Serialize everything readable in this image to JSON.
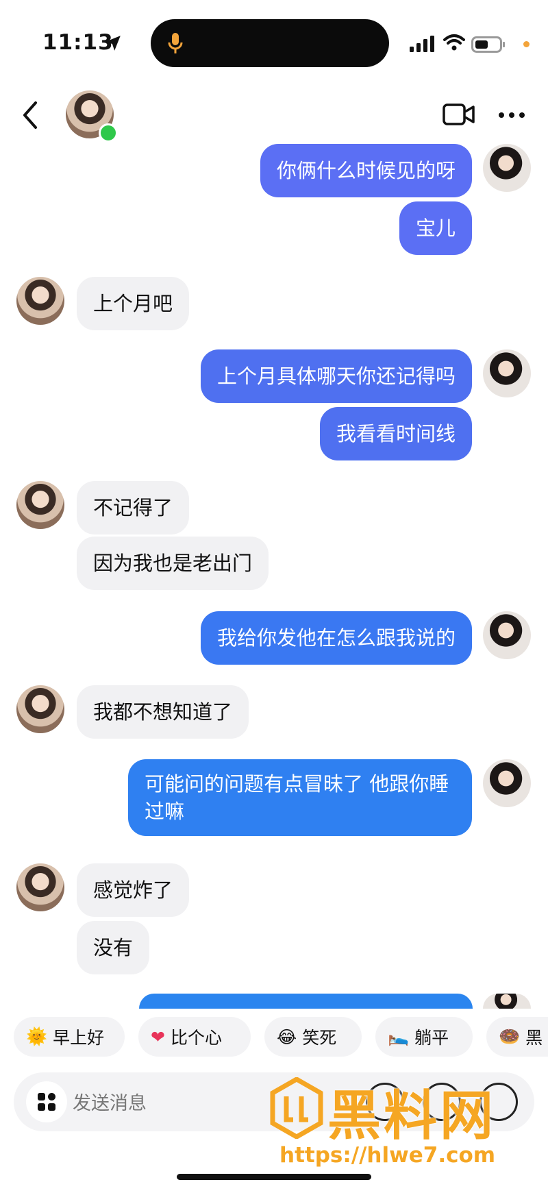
{
  "status": {
    "time": "11:13"
  },
  "messages": [
    {
      "side": "out",
      "text": "你俩什么时候见的呀",
      "color": "#5b6ff4"
    },
    {
      "side": "out",
      "text": "宝儿",
      "color": "#5b6ff4"
    },
    {
      "side": "in",
      "text": "上个月吧"
    },
    {
      "side": "out",
      "text": "上个月具体哪天你还记得吗",
      "color": "#4f70f0"
    },
    {
      "side": "out",
      "text": "我看看时间线",
      "color": "#4f70f0"
    },
    {
      "side": "in",
      "text": "不记得了"
    },
    {
      "side": "in",
      "text": "因为我也是老出门"
    },
    {
      "side": "out",
      "text": "我给你发他在怎么跟我说的",
      "color": "#3a78f2"
    },
    {
      "side": "in",
      "text": "我都不想知道了"
    },
    {
      "side": "out",
      "text": "可能问的问题有点冒昧了 他跟你睡过嘛",
      "line1": "可能问的问题有点冒昧了 他跟你睡",
      "line2": "过嘛",
      "color": "#2f80f1"
    },
    {
      "side": "in",
      "text": "感觉炸了"
    },
    {
      "side": "in",
      "text": "没有"
    }
  ],
  "quick_replies": [
    {
      "icon": "🌞",
      "label": "早上好"
    },
    {
      "icon": "❤",
      "label": "比个心"
    },
    {
      "icon": "😂",
      "label": "笑死"
    },
    {
      "icon": "🛌",
      "label": "躺平"
    },
    {
      "icon": "🍩",
      "label": "黑"
    }
  ],
  "input": {
    "placeholder": "发送消息"
  },
  "watermark": {
    "title": "黑料网",
    "url": "https://hlwe7.com"
  },
  "colors": {
    "online": "#2fc84a",
    "watermark": "#f5a623"
  }
}
